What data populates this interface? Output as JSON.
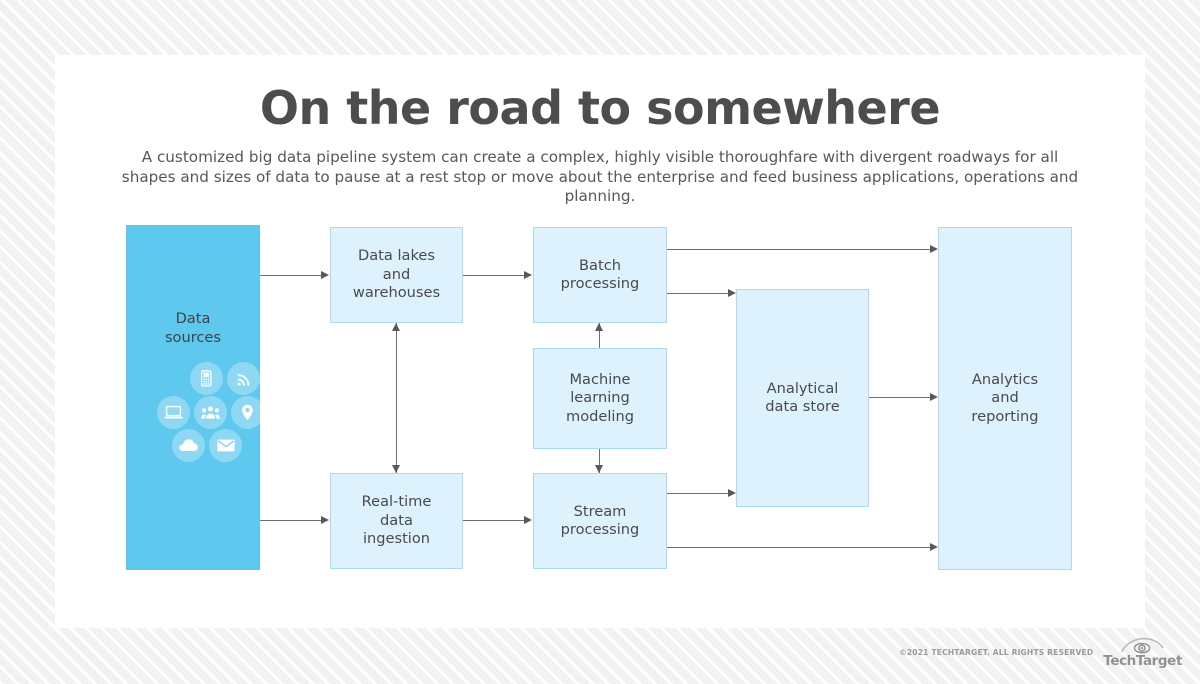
{
  "headline": "On the road to somewhere",
  "subhead": "A customized big data pipeline system can create a complex, highly visible thoroughfare with divergent roadways for all shapes and sizes of data to pause at a rest stop or move about the enterprise and feed business applications, operations and planning.",
  "colors": {
    "source_panel": "#5fc8ee",
    "node_fill": "#ddf2fc",
    "node_border": "#a9dcf2",
    "connector": "#6d6e71",
    "text": "#4a4a4c",
    "headline_text": "#4d4d4d",
    "page_background": "#f2f2f2",
    "card_background": "#ffffff"
  },
  "diagram": {
    "nodes": [
      {
        "id": "data-sources",
        "label": "Data\nsources"
      },
      {
        "id": "data-lakes-and-warehouses",
        "label": "Data lakes\nand\nwarehouses"
      },
      {
        "id": "real-time-data-ingestion",
        "label": "Real-time\ndata\ningestion"
      },
      {
        "id": "batch-processing",
        "label": "Batch\nprocessing"
      },
      {
        "id": "machine-learning-modeling",
        "label": "Machine\nlearning\nmodeling"
      },
      {
        "id": "stream-processing",
        "label": "Stream\nprocessing"
      },
      {
        "id": "analytical-data-store",
        "label": "Analytical\ndata store"
      },
      {
        "id": "analytics-and-reporting",
        "label": "Analytics\nand\nreporting"
      }
    ],
    "source_icons": [
      "mobile-phone-icon",
      "rss-signal-icon",
      "laptop-icon",
      "people-group-icon",
      "location-pin-icon",
      "cloud-icon",
      "envelope-icon"
    ],
    "connections": [
      {
        "from": "data-sources",
        "to": "data-lakes-and-warehouses",
        "direction": "one-way"
      },
      {
        "from": "data-sources",
        "to": "real-time-data-ingestion",
        "direction": "one-way"
      },
      {
        "from": "data-lakes-and-warehouses",
        "to": "batch-processing",
        "direction": "one-way"
      },
      {
        "from": "real-time-data-ingestion",
        "to": "stream-processing",
        "direction": "one-way"
      },
      {
        "from": "data-lakes-and-warehouses",
        "to": "real-time-data-ingestion",
        "direction": "two-way"
      },
      {
        "from": "machine-learning-modeling",
        "to": "batch-processing",
        "direction": "one-way"
      },
      {
        "from": "machine-learning-modeling",
        "to": "stream-processing",
        "direction": "one-way"
      },
      {
        "from": "batch-processing",
        "to": "analytics-and-reporting",
        "direction": "one-way"
      },
      {
        "from": "batch-processing",
        "to": "analytical-data-store",
        "direction": "one-way"
      },
      {
        "from": "stream-processing",
        "to": "analytical-data-store",
        "direction": "one-way"
      },
      {
        "from": "stream-processing",
        "to": "analytics-and-reporting",
        "direction": "one-way"
      },
      {
        "from": "analytical-data-store",
        "to": "analytics-and-reporting",
        "direction": "one-way"
      }
    ]
  },
  "footer": {
    "copyright": "©2021 TECHTARGET. ALL RIGHTS RESERVED",
    "logo_word": "TechTarget",
    "logo_mark": "eye-logo-icon"
  }
}
